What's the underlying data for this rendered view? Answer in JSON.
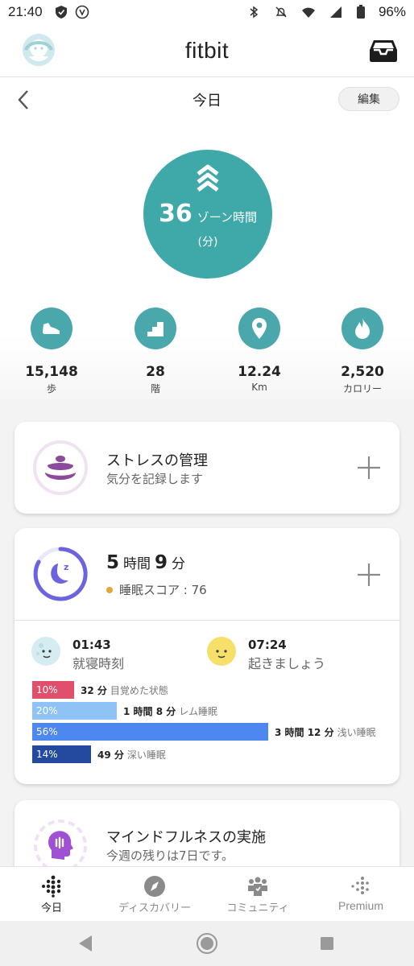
{
  "status_bar": {
    "time": "21:40",
    "battery": "96%"
  },
  "header": {
    "logo": "fitbit",
    "avatar_icon": "avatar-icon",
    "inbox_icon": "inbox-icon"
  },
  "nav": {
    "title": "今日",
    "edit_label": "編集"
  },
  "zone": {
    "value": "36",
    "label": "ゾーン時間",
    "unit": "(分)"
  },
  "stats": [
    {
      "icon": "shoe-icon",
      "value": "15,148",
      "label": "歩"
    },
    {
      "icon": "stairs-icon",
      "value": "28",
      "label": "階"
    },
    {
      "icon": "location-pin-icon",
      "value": "12.24",
      "label": "Km"
    },
    {
      "icon": "flame-icon",
      "value": "2,520",
      "label": "カロリー"
    }
  ],
  "stress": {
    "title": "ストレスの管理",
    "subtitle": "気分を記録します"
  },
  "sleep": {
    "hours": "5",
    "hours_unit": "時間",
    "minutes": "9",
    "minutes_unit": "分",
    "score_label": "睡眠スコア : 76",
    "score": 76,
    "bedtime": "01:43",
    "bedtime_label": "就寝時刻",
    "wake": "07:24",
    "wake_label": "起きましょう",
    "stages": [
      {
        "percent_label": "10%",
        "fraction": 0.1,
        "duration": "32 分",
        "name": "目覚めた状態",
        "color": "#e0506d"
      },
      {
        "percent_label": "20%",
        "fraction": 0.2,
        "duration": "1 時間 8 分",
        "name": "レム睡眠",
        "color": "#8fc3f5"
      },
      {
        "percent_label": "56%",
        "fraction": 0.56,
        "duration": "3 時間 12 分",
        "name": "浅い睡眠",
        "color": "#4d87f0"
      },
      {
        "percent_label": "14%",
        "fraction": 0.14,
        "duration": "49 分",
        "name": "深い睡眠",
        "color": "#234a9e"
      }
    ]
  },
  "mindfulness": {
    "title": "マインドフルネスの実施",
    "subtitle": "今週の残りは7日です。"
  },
  "bottom_nav": [
    {
      "label": "今日",
      "icon": "fitbit-dots-icon",
      "active": true
    },
    {
      "label": "ディスカバリー",
      "icon": "compass-icon",
      "active": false
    },
    {
      "label": "コミュニティ",
      "icon": "community-icon",
      "active": false
    },
    {
      "label": "Premium",
      "icon": "premium-dots-icon",
      "active": false
    }
  ],
  "colors": {
    "teal": "#3fa9a9",
    "stat_teal": "#4aa8ad",
    "purple": "#8b4a9c",
    "sleep_blue": "#6b63e0"
  }
}
